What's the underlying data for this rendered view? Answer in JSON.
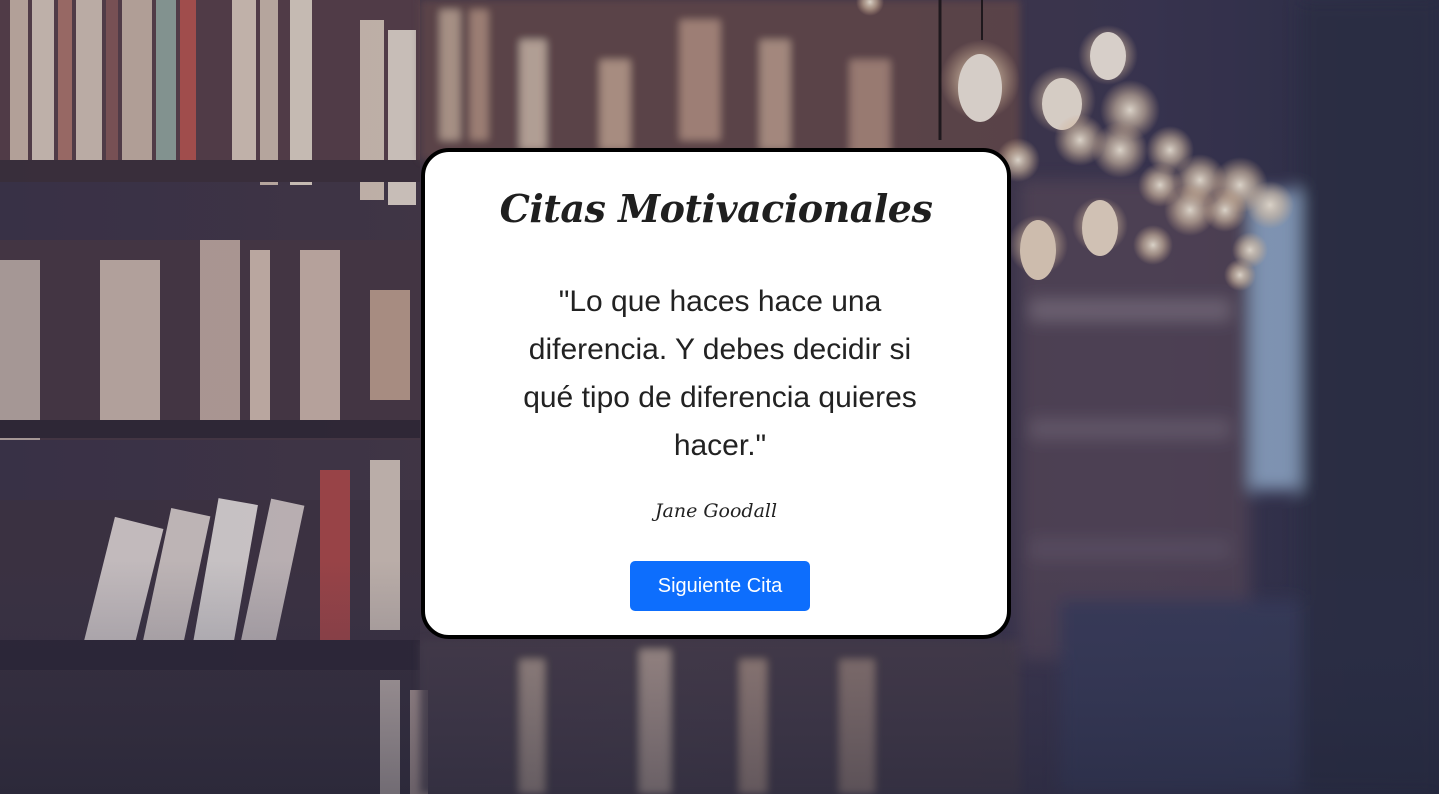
{
  "background": {
    "image": "library-bookshelves-with-hanging-lightbulbs",
    "tint": "#2e2e44"
  },
  "card": {
    "title": "Citas Motivacionales",
    "quote": "\"Lo que haces hace una diferencia. Y debes decidir si qué tipo de diferencia quieres hacer.\"",
    "author": "Jane Goodall",
    "button_label": "Siguiente Cita"
  },
  "colors": {
    "button": "#0d6efd",
    "card_border": "#000000",
    "card_bg": "#ffffff"
  }
}
